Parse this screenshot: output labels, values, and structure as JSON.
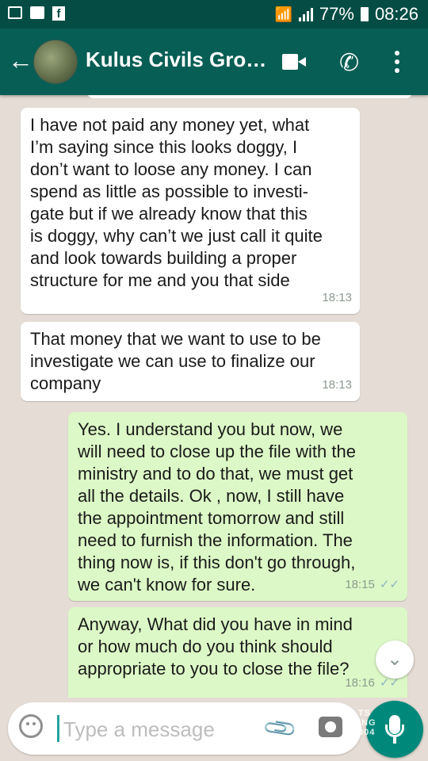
{
  "status_bar": {
    "battery": "77%",
    "time": "08:26"
  },
  "header": {
    "back_icon": "arrow-left-icon",
    "title": "Kulus Civils Grou…",
    "icons": [
      "video-call-icon",
      "phone-icon",
      "more-vert-icon"
    ]
  },
  "messages": [
    {
      "direction": "in",
      "text": "I have not paid any money yet, what\nI’m saying since this looks doggy, I\ndon’t want to loose any money. I can\nspend as little as possible to investi-\ngate but if we already know that this\nis doggy, why can’t we just call it quite\nand look towards building a proper\nstructure for me and you that side",
      "time": "18:13"
    },
    {
      "direction": "in",
      "text": "That money that we want to use to be\ninvestigate we can use to finalize our\ncompany",
      "time": "18:13"
    },
    {
      "direction": "out",
      "text": "Yes. I understand you but now, we\nwill need to close up the file with the\nministry and to do that, we must get\nall the details.  Ok , now, I still have\nthe appointment tomorrow and still\nneed to furnish the information.  The\nthing now is, if this don't go through,\nwe can't know for sure.",
      "time": "18:15",
      "status": "read"
    },
    {
      "direction": "out",
      "text": "Anyway, What did you have in mind\nor how much do you think should\nappropriate to you to close the file?",
      "time": "18:16",
      "status": "read"
    }
  ],
  "composer": {
    "placeholder": "Type a message",
    "value": "",
    "icons": [
      "emoji-icon",
      "attach-icon",
      "camera-icon",
      "mic-icon"
    ]
  },
  "watermark": "TS\nING\n004",
  "colors": {
    "header": "#075e54",
    "status_bar": "#054d44",
    "outgoing_bubble": "#dcf8c6",
    "incoming_bubble": "#ffffff",
    "chat_background": "#e5ddd5",
    "accent": "#00897b"
  }
}
